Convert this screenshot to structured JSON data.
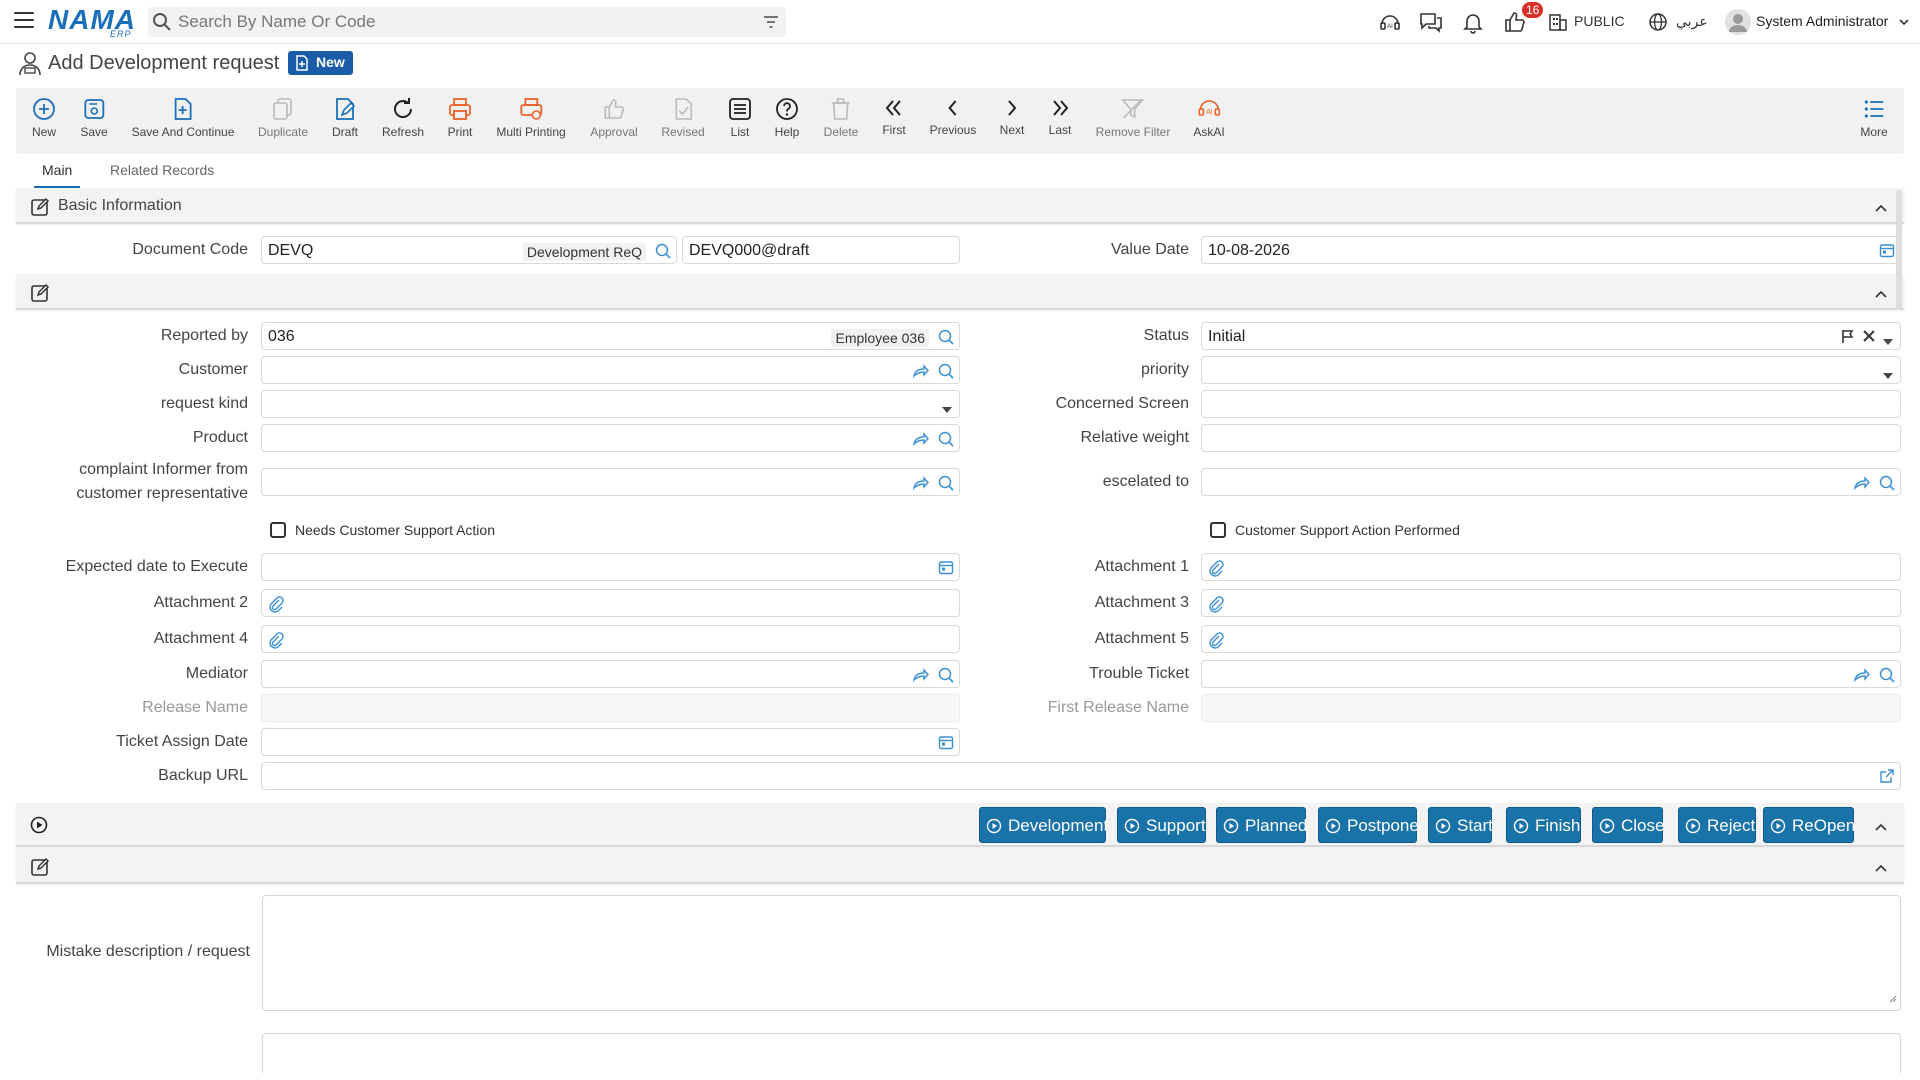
{
  "app": {
    "logo": "NAMA",
    "logo_sub": "ERP"
  },
  "search": {
    "placeholder": "Search By Name Or Code"
  },
  "topbar": {
    "notifications_count": "16",
    "branch": "PUBLIC",
    "language": "عربي",
    "user": "System Administrator"
  },
  "page": {
    "title": "Add Development request",
    "badge": "New"
  },
  "toolbar": [
    {
      "label": "New",
      "icon": "plus-circle-icon",
      "enabled": true
    },
    {
      "label": "Save",
      "icon": "save-icon",
      "enabled": true
    },
    {
      "label": "Save And Continue",
      "icon": "save-continue-icon",
      "enabled": true
    },
    {
      "label": "Duplicate",
      "icon": "duplicate-icon",
      "enabled": false
    },
    {
      "label": "Draft",
      "icon": "draft-icon",
      "enabled": true
    },
    {
      "label": "Refresh",
      "icon": "refresh-icon",
      "enabled": true
    },
    {
      "label": "Print",
      "icon": "print-icon",
      "enabled": true
    },
    {
      "label": "Multi Printing",
      "icon": "multi-print-icon",
      "enabled": true
    },
    {
      "label": "Approval",
      "icon": "thumbs-up-icon",
      "enabled": false
    },
    {
      "label": "Revised",
      "icon": "revised-icon",
      "enabled": false
    },
    {
      "label": "List",
      "icon": "list-icon",
      "enabled": true
    },
    {
      "label": "Help",
      "icon": "help-icon",
      "enabled": true
    },
    {
      "label": "Delete",
      "icon": "trash-icon",
      "enabled": false
    },
    {
      "label": "First",
      "icon": "first-icon",
      "enabled": true
    },
    {
      "label": "Previous",
      "icon": "previous-icon",
      "enabled": true
    },
    {
      "label": "Next",
      "icon": "next-icon",
      "enabled": true
    },
    {
      "label": "Last",
      "icon": "last-icon",
      "enabled": true
    },
    {
      "label": "Remove Filter",
      "icon": "remove-filter-icon",
      "enabled": false
    },
    {
      "label": "AskAI",
      "icon": "ai-icon",
      "enabled": true
    },
    {
      "label": "More",
      "icon": "more-icon",
      "enabled": true
    }
  ],
  "tabs": {
    "main": "Main",
    "related": "Related Records"
  },
  "basic": {
    "title": "Basic Information",
    "doc_code_label": "Document Code",
    "doc_code_value": "DEVQ",
    "doc_code_tag": "Development ReQ",
    "doc_number": "DEVQ000@draft",
    "value_date_label": "Value Date",
    "value_date": "10-08-2026"
  },
  "details": {
    "reported_by_label": "Reported by",
    "reported_by_value": "036",
    "reported_by_tag": "Employee 036",
    "status_label": "Status",
    "status_value": "Initial",
    "customer_label": "Customer",
    "priority_label": "priority",
    "request_kind_label": "request kind",
    "concerned_screen_label": "Concerned Screen",
    "product_label": "Product",
    "relative_weight_label": "Relative weight",
    "complaint_label_1": "complaint Informer from",
    "complaint_label_2": "customer representative",
    "escalated_label": "escelated to",
    "needs_support_label": "Needs Customer Support Action",
    "support_performed_label": "Customer Support Action Performed",
    "expected_date_label": "Expected date to Execute",
    "attachment1_label": "Attachment 1",
    "attachment2_label": "Attachment 2",
    "attachment3_label": "Attachment 3",
    "attachment4_label": "Attachment 4",
    "attachment5_label": "Attachment 5",
    "mediator_label": "Mediator",
    "trouble_ticket_label": "Trouble Ticket",
    "release_name_label": "Release Name",
    "first_release_label": "First Release Name",
    "ticket_assign_label": "Ticket Assign Date",
    "backup_url_label": "Backup URL"
  },
  "workflow": [
    "Development",
    "Support",
    "Planned",
    "Postpone",
    "Start",
    "Finish",
    "Close",
    "Reject",
    "ReOpen"
  ],
  "description": {
    "label": "Mistake description / request"
  },
  "colors": {
    "accent": "#1b6fb8",
    "workflow_button": "#1a73a8",
    "badge": "#d9302c",
    "print_orange": "#e8622a"
  }
}
